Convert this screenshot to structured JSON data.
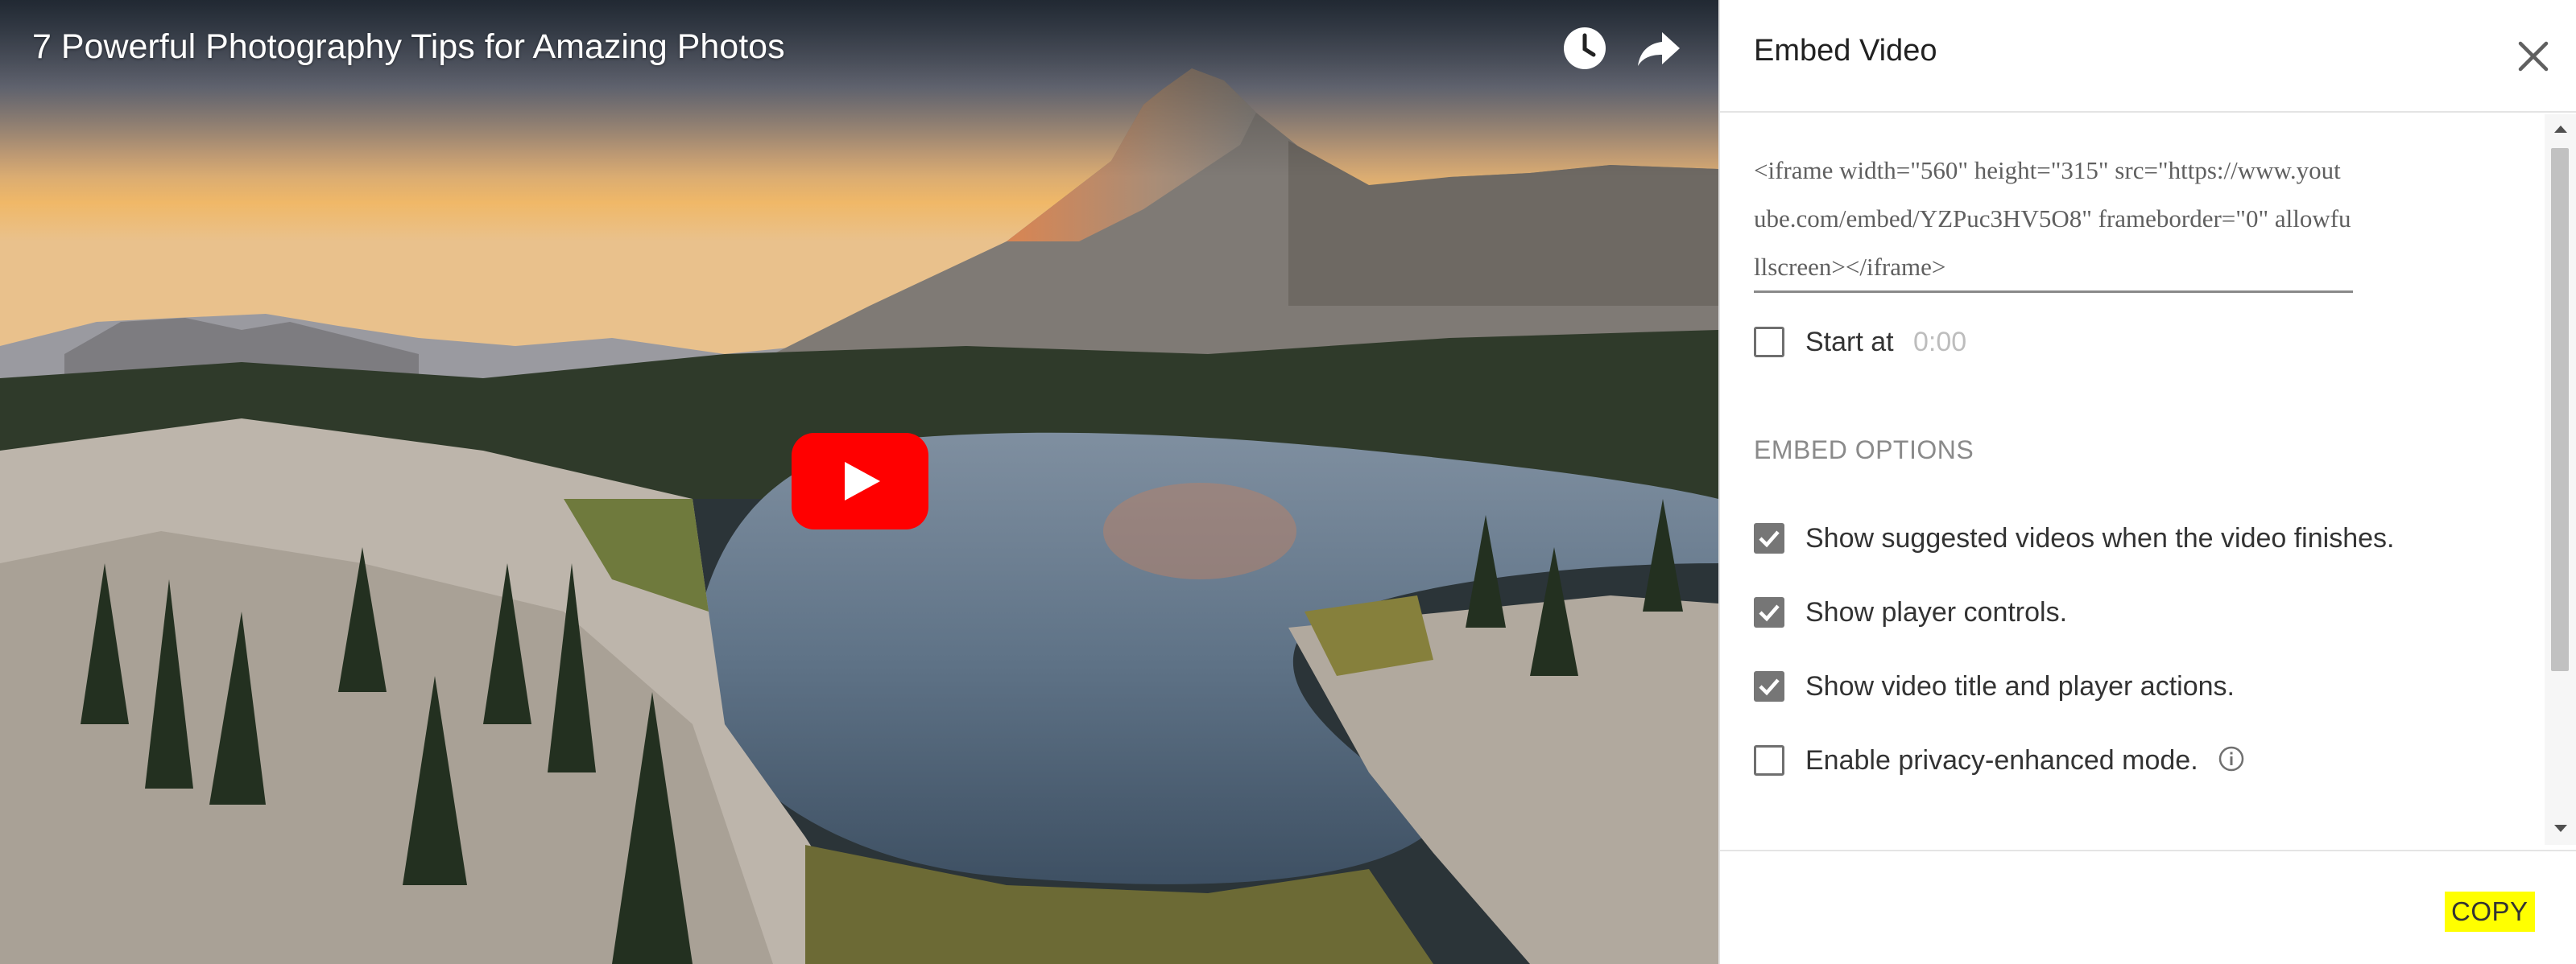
{
  "video": {
    "title": "7 Powerful Photography Tips for Amazing Photos",
    "watch_later_icon": "clock-icon",
    "share_icon": "share-arrow-icon",
    "play_icon": "youtube-play-icon",
    "play_color": "#ff0000"
  },
  "dialog": {
    "title": "Embed Video",
    "close_icon": "close-icon",
    "embed_code": "<iframe width=\"560\" height=\"315\" src=\"https://www.youtube.com/embed/YZPuc3HV5O8\" frameborder=\"0\" allowfullscreen></iframe>",
    "start_at": {
      "label": "Start at",
      "value": "0:00",
      "checked": false
    },
    "section_header": "EMBED OPTIONS",
    "options": [
      {
        "label": "Show suggested videos when the video finishes.",
        "checked": true
      },
      {
        "label": "Show player controls.",
        "checked": true
      },
      {
        "label": "Show video title and player actions.",
        "checked": true
      },
      {
        "label": "Enable privacy-enhanced mode.",
        "checked": false
      }
    ],
    "info_icon": "info-icon",
    "copy_label": "COPY",
    "copy_highlight": "#ffff00"
  }
}
